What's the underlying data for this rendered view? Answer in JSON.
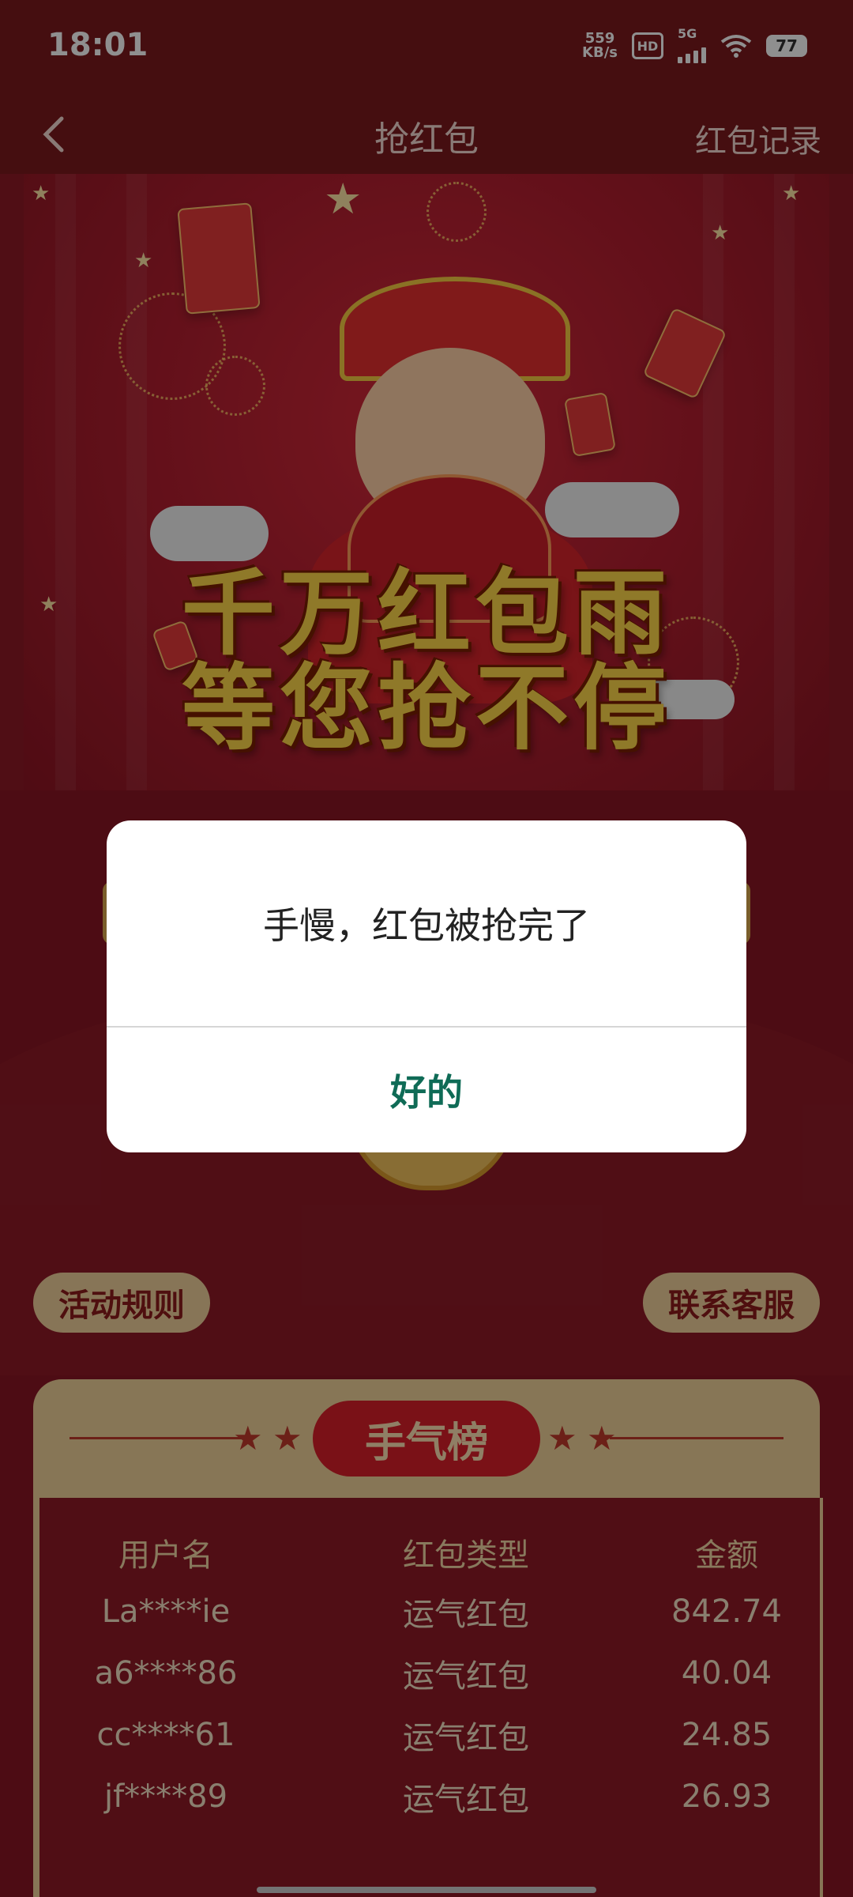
{
  "status_bar": {
    "time": "18:01",
    "speed_value": "559",
    "speed_unit": "KB/s",
    "hd": "HD",
    "network": "5G",
    "battery": "77"
  },
  "nav": {
    "title": "抢红包",
    "right_link": "红包记录"
  },
  "banner": {
    "line1": "千万红包雨",
    "line2": "等您抢不停"
  },
  "buttons": {
    "rules": "活动规则",
    "service": "联系客服"
  },
  "leaderboard": {
    "title": "手气榜",
    "columns": [
      "用户名",
      "红包类型",
      "金额"
    ],
    "rows": [
      {
        "user": "La****ie",
        "type": "运气红包",
        "amount": "842.74"
      },
      {
        "user": "a6****86",
        "type": "运气红包",
        "amount": "40.04"
      },
      {
        "user": "cc****61",
        "type": "运气红包",
        "amount": "24.85"
      },
      {
        "user": "jf****89",
        "type": "运气红包",
        "amount": "26.93"
      }
    ]
  },
  "dialog": {
    "message": "手慢，红包被抢完了",
    "confirm": "好的"
  }
}
